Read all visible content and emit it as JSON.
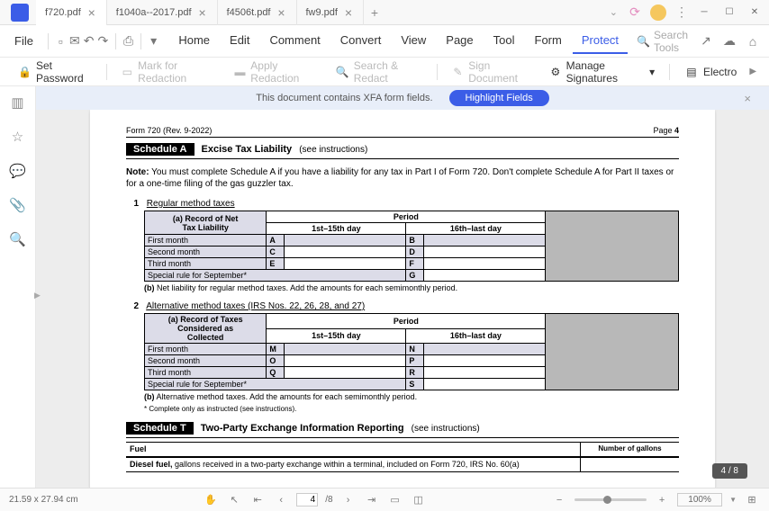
{
  "tabs": [
    {
      "label": "f720.pdf",
      "active": true
    },
    {
      "label": "f1040a--2017.pdf",
      "active": false
    },
    {
      "label": "f4506t.pdf",
      "active": false
    },
    {
      "label": "fw9.pdf",
      "active": false
    }
  ],
  "menu": {
    "file": "File",
    "items": [
      "Home",
      "Edit",
      "Comment",
      "Convert",
      "View",
      "Page",
      "Tool",
      "Form",
      "Protect"
    ],
    "active": "Protect",
    "search_placeholder": "Search Tools"
  },
  "toolbar": {
    "set_password": "Set Password",
    "mark_redaction": "Mark for Redaction",
    "apply_redaction": "Apply Redaction",
    "search_redact": "Search & Redact",
    "sign_document": "Sign Document",
    "manage_signatures": "Manage Signatures",
    "electro": "Electro"
  },
  "notice": {
    "text": "This document contains XFA form fields.",
    "button": "Highlight Fields"
  },
  "form": {
    "header_left": "Form 720 (Rev. 9-2022)",
    "header_right_label": "Page",
    "header_right_num": "4",
    "schedA": {
      "tag": "Schedule A",
      "title": "Excise Tax Liability",
      "instr": "(see instructions)"
    },
    "note_label": "Note:",
    "note_text": "You must complete Schedule A if you have a liability for any tax in Part I of Form 720. Don't complete Schedule A for Part II taxes or for a one-time filing of the gas guzzler tax.",
    "sec1": {
      "num": "1",
      "title": "Regular method taxes",
      "a_tag": "(a)",
      "a_label1": "Record of Net",
      "a_label2": "Tax Liability",
      "period": "Period",
      "col1": "1st–15th day",
      "col2": "16th–last day",
      "rows": [
        {
          "label": "First month",
          "l1": "A",
          "l2": "B"
        },
        {
          "label": "Second month",
          "l1": "C",
          "l2": "D"
        },
        {
          "label": "Third month",
          "l1": "E",
          "l2": "F"
        },
        {
          "label": "Special rule for September*",
          "l1": "",
          "l2": "G"
        }
      ],
      "b_tag": "(b)",
      "b_text": "Net liability for regular method taxes. Add the amounts for each semimonthly period."
    },
    "sec2": {
      "num": "2",
      "title": "Alternative method taxes (IRS Nos. 22, 26, 28, and 27)",
      "a_tag": "(a)",
      "a_label1": "Record of Taxes",
      "a_label2": "Considered as",
      "a_label3": "Collected",
      "period": "Period",
      "col1": "1st–15th day",
      "col2": "16th–last day",
      "rows": [
        {
          "label": "First month",
          "l1": "M",
          "l2": "N"
        },
        {
          "label": "Second month",
          "l1": "O",
          "l2": "P"
        },
        {
          "label": "Third month",
          "l1": "Q",
          "l2": "R"
        },
        {
          "label": "Special rule for September*",
          "l1": "",
          "l2": "S"
        }
      ],
      "b_tag": "(b)",
      "b_text": "Alternative method taxes. Add the amounts for each semimonthly period."
    },
    "asterisk": "* Complete only as instructed (see instructions).",
    "schedT": {
      "tag": "Schedule T",
      "title": "Two-Party Exchange Information Reporting",
      "instr": "(see instructions)"
    },
    "fuel_hdr": "Fuel",
    "gallons_hdr": "Number of gallons",
    "diesel_bold": "Diesel fuel,",
    "diesel_text": "gallons received in a two-party exchange within a terminal, included on Form 720, IRS No. 60(a)"
  },
  "page_indicator": "4 / 8",
  "status": {
    "dimensions": "21.59 x 27.94 cm",
    "current_page": "4",
    "total_pages": "/8",
    "zoom": "100%"
  }
}
